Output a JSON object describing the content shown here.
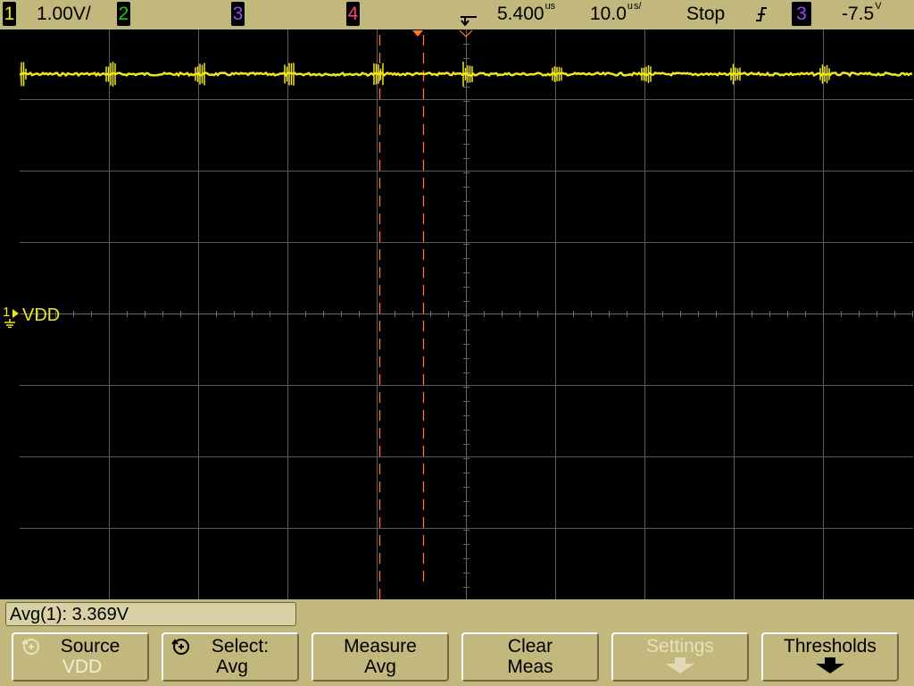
{
  "topbar": {
    "ch1_num": "1",
    "ch1_scale": "1.00V/",
    "ch2_num": "2",
    "ch3_num": "3",
    "ch4_num": "4",
    "time_delay": "5.400",
    "time_delay_unit": "us",
    "time_scale": "10.0",
    "time_scale_unit": "s/",
    "time_scale_prefix": "u",
    "run_state": "Stop",
    "trigger_edge_icon": "rising-edge-icon",
    "trigger_source": "3",
    "trigger_level": "-7.5",
    "trigger_level_unit": "V"
  },
  "colors": {
    "bezel": "#c2b77c",
    "ch1": "#f0e61e",
    "ch2": "#22c522",
    "ch3": "#9a44ff",
    "ch4": "#ff4070",
    "cursor": "#ff7a2a",
    "grid": "#5a5a5a"
  },
  "scope": {
    "channel_label_num": "1",
    "channel_label": "VDD"
  },
  "measurement": {
    "readout": "Avg(1): 3.369V"
  },
  "softkeys": [
    {
      "line1": "Source",
      "line2": "VDD",
      "icon": "rotate-knob-icon",
      "enabled": true
    },
    {
      "line1": "Select:",
      "line2": "Avg",
      "icon": "rotate-knob-icon",
      "enabled": true
    },
    {
      "line1": "Measure",
      "line2": "Avg",
      "enabled": true
    },
    {
      "line1": "Clear",
      "line2": "Meas",
      "enabled": true
    },
    {
      "line1": "Settings",
      "line2": "",
      "icon": "down-arrow-icon",
      "enabled": false
    },
    {
      "line1": "Thresholds",
      "line2": "",
      "icon": "down-arrow-icon",
      "enabled": true
    }
  ]
}
